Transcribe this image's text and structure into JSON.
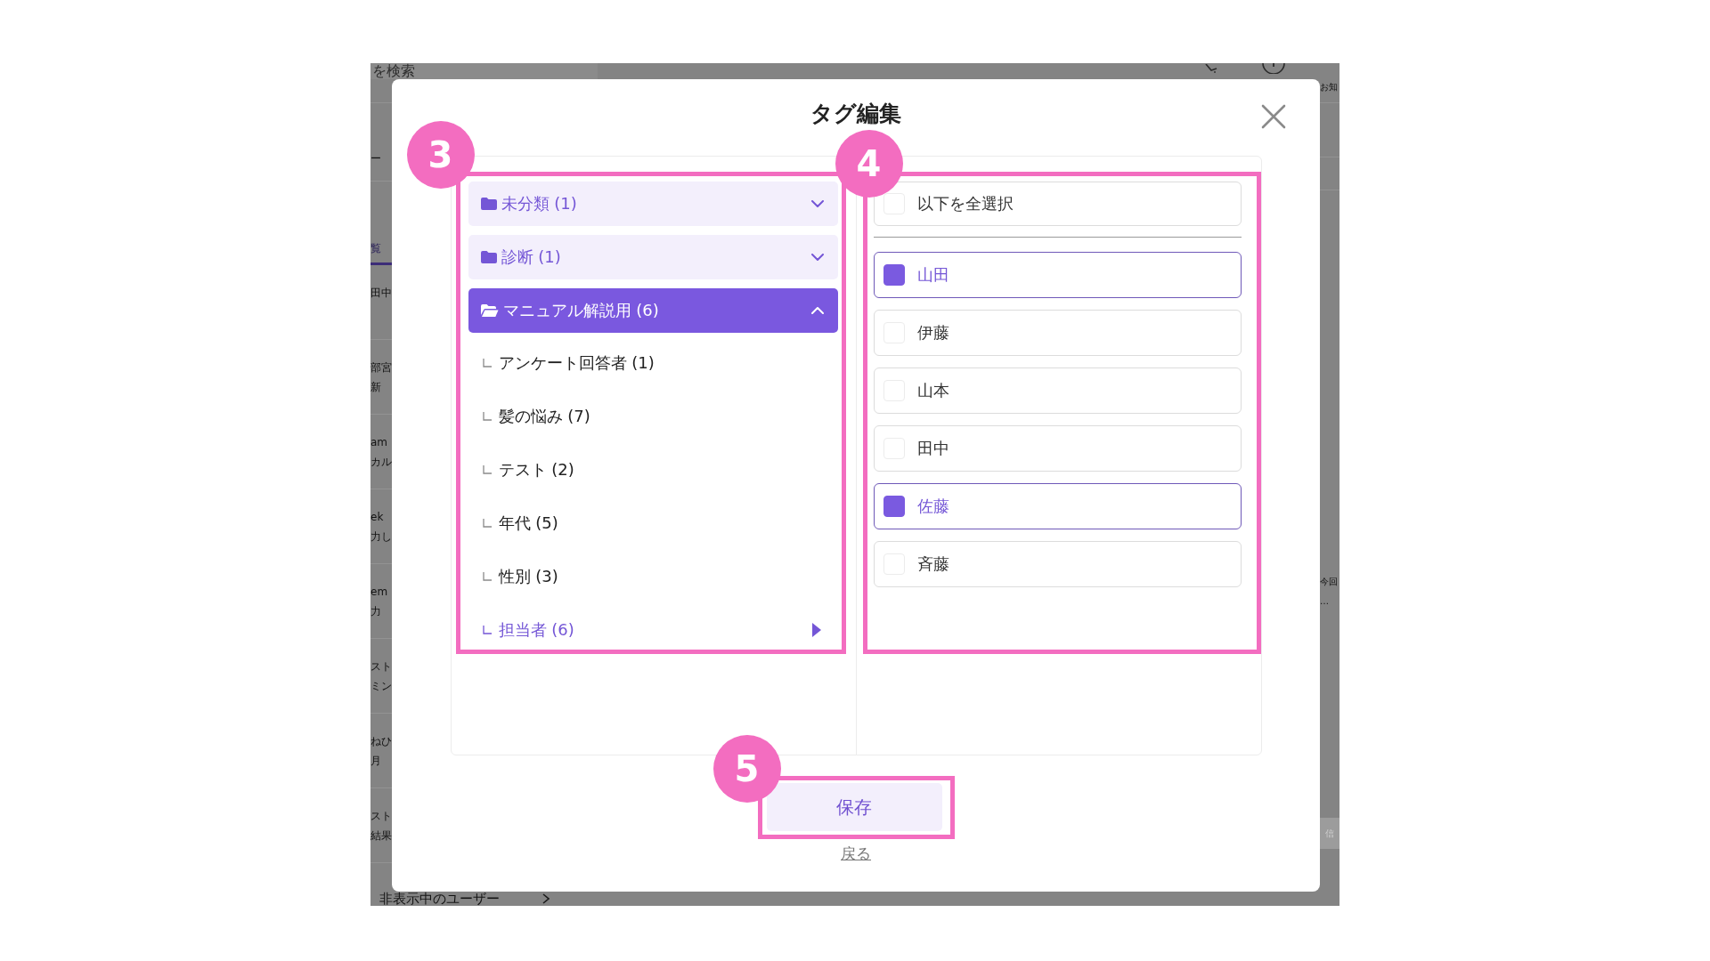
{
  "background_app": {
    "search": {
      "placeholder": "を検索"
    },
    "notice_label": "お知",
    "section_fragment": "ー",
    "tabs": [
      {
        "label": "覧",
        "selected": true
      }
    ],
    "list_rows": [
      {
        "title": "田中"
      },
      {
        "title": "部宮",
        "subtitle": "新"
      },
      {
        "title": "am",
        "subtitle": "カル"
      },
      {
        "title": "ek",
        "subtitle": "力し"
      },
      {
        "title": "em",
        "subtitle": "力"
      },
      {
        "title": "スト",
        "subtitle": "ミン"
      },
      {
        "title": "ねひ",
        "subtitle": "月"
      },
      {
        "title": "スト",
        "subtitle": "結果"
      }
    ],
    "side_texts": [
      "今回",
      "…"
    ],
    "side_button": "信",
    "hidden_users_link": "非表示中のユーザー"
  },
  "dialog": {
    "title": "タグ編集",
    "tag_panel": {
      "step": "3",
      "groups": [
        {
          "label": "未分類 (1)",
          "expanded": false
        },
        {
          "label": "診断 (1)",
          "expanded": false
        },
        {
          "label": "マニュアル解説用 (6)",
          "expanded": true,
          "children": [
            {
              "label": "アンケート回答者 (1)",
              "selected": false
            },
            {
              "label": "髪の悩み (7)",
              "selected": false
            },
            {
              "label": "テスト (2)",
              "selected": false
            },
            {
              "label": "年代 (5)",
              "selected": false
            },
            {
              "label": "性別 (3)",
              "selected": false
            },
            {
              "label": "担当者 (6)",
              "selected": true
            }
          ]
        }
      ]
    },
    "member_panel": {
      "step": "4",
      "select_all": {
        "label": "以下を全選択",
        "checked": false
      },
      "members": [
        {
          "name": "山田",
          "checked": true
        },
        {
          "name": "伊藤",
          "checked": false
        },
        {
          "name": "山本",
          "checked": false
        },
        {
          "name": "田中",
          "checked": false
        },
        {
          "name": "佐藤",
          "checked": true
        },
        {
          "name": "斉藤",
          "checked": false
        }
      ]
    },
    "footer": {
      "step": "5",
      "save_button": "保存",
      "back_link": "戻る"
    }
  }
}
